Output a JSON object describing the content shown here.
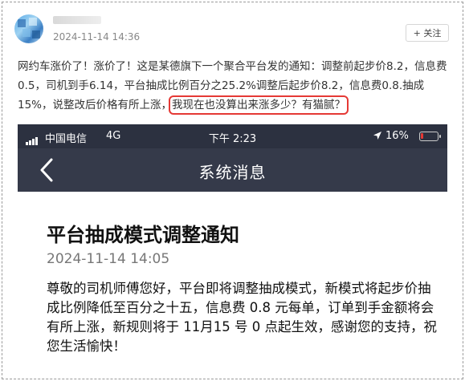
{
  "post": {
    "timestamp": "2024-11-14 14:36",
    "follow_label": "+ 关注",
    "text_before": "网约车涨价了！涨价了！这是某德旗下一个聚合平台发的通知：调整前起步价8.2，信息费0.5，司机到手6.14，平台抽成比例百分之25.2%调整后起步价8.2，信息费0.8.抽成15%，说整改后价格有所上涨，",
    "text_highlight": "我现在也没算出来涨多少？有猫腻？"
  },
  "phone": {
    "carrier": "中国电信",
    "network": "4G",
    "time": "下午 2:23",
    "location_icon": "location-arrow-icon",
    "battery_pct": "16%",
    "battery_level": 0.16,
    "battery_color": "#e53935",
    "nav_title": "系统消息"
  },
  "notice": {
    "title": "平台抽成模式调整通知",
    "date": "2024-11-14 14:05",
    "body": "尊敬的司机师傅您好，平台即将调整抽成模式，新模式将起步价抽成比例降低至百分之十五，信息费 0.8 元每单，订单到手金额将会有所上涨，新规则将于 11月15 号 0 点起生效，感谢您的支持，祝您生活愉快！"
  },
  "colors": {
    "highlight_border": "#e53935",
    "nav_bg": "#353a4a",
    "status_bg": "#2c3140"
  }
}
